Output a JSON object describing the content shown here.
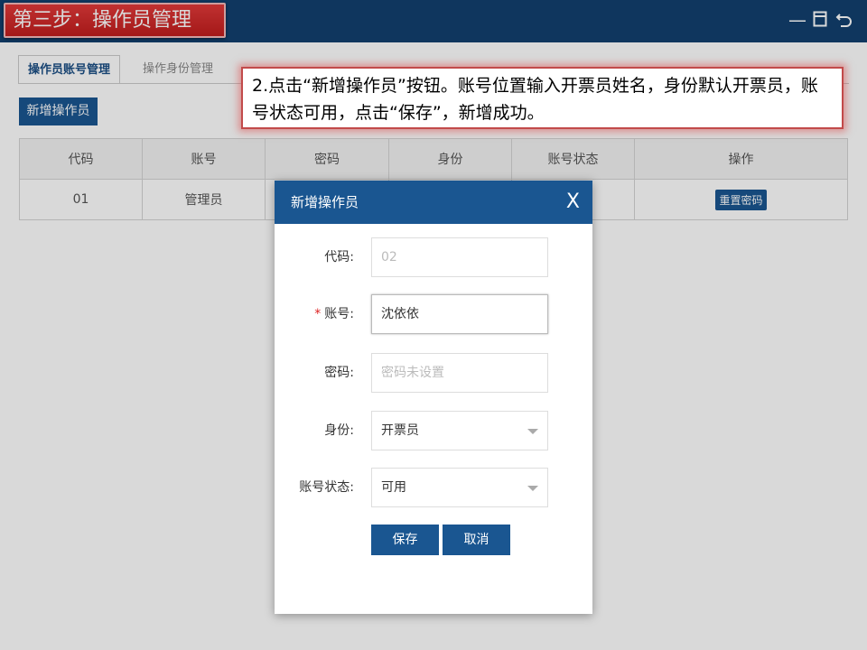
{
  "header": {
    "step_title": "第三步：操作员管理",
    "minimize_icon": "minimize-icon",
    "maximize_icon": "maximize-icon",
    "back_icon": "back-icon"
  },
  "tabs": [
    {
      "label": "操作员账号管理",
      "active": true
    },
    {
      "label": "操作身份管理",
      "active": false
    }
  ],
  "toolbar": {
    "add_label": "新增操作员"
  },
  "table": {
    "columns": [
      "代码",
      "账号",
      "密码",
      "身份",
      "账号状态",
      "操作"
    ],
    "rows": [
      {
        "code": "01",
        "account": "管理员",
        "action": "重置密码"
      }
    ]
  },
  "instruction": "2.点击“新增操作员”按钮。账号位置输入开票员姓名，身份默认开票员，账号状态可用，点击“保存”，新增成功。",
  "modal": {
    "title": "新增操作员",
    "close": "X",
    "fields": {
      "code": {
        "label": "代码:",
        "value": "02"
      },
      "account": {
        "label": "账号:",
        "required_mark": "*",
        "value": "沈依依"
      },
      "password": {
        "label": "密码:",
        "placeholder": "密码未设置"
      },
      "role": {
        "label": "身份:",
        "value": "开票员"
      },
      "status": {
        "label": "账号状态:",
        "value": "可用"
      }
    },
    "save_label": "保存",
    "cancel_label": "取消"
  },
  "colors": {
    "primary": "#1a5691",
    "header": "#12406f",
    "step_badge": "#d32b2b",
    "required": "#dd2222"
  }
}
